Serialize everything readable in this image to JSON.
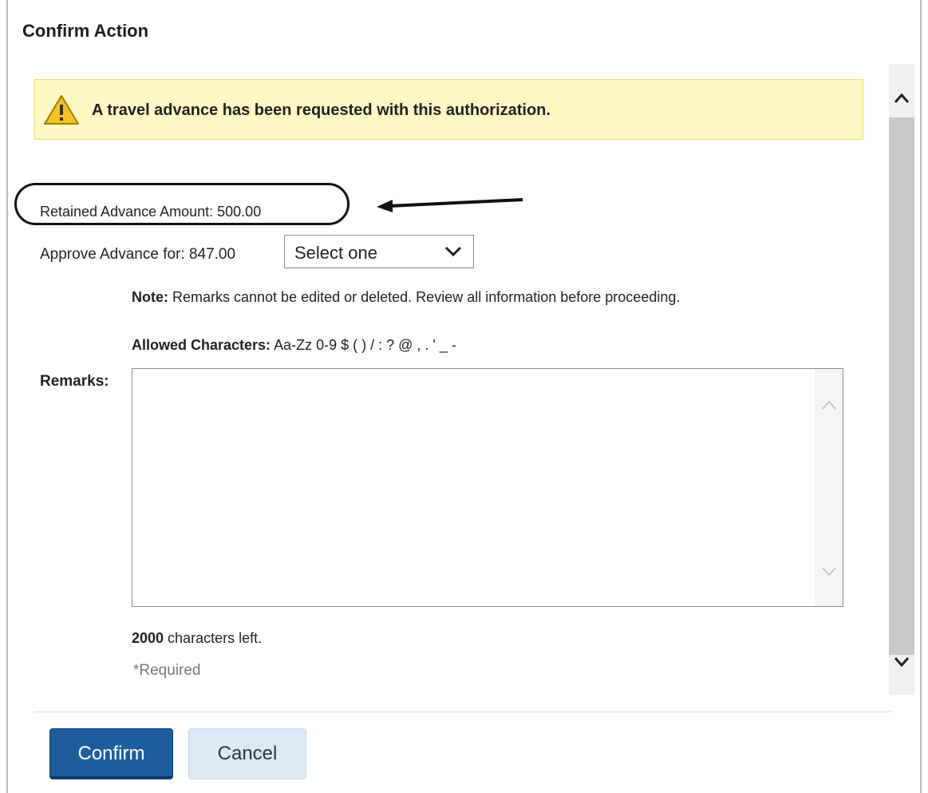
{
  "dialog": {
    "title": "Confirm Action"
  },
  "alert": {
    "icon": "warning-icon",
    "message": "A travel advance has been requested with this authorization."
  },
  "retained": {
    "label": "Retained Advance Amount: 500.00"
  },
  "approve": {
    "label": "Approve Advance for: 847.00",
    "select_value": "Select one"
  },
  "note": {
    "prefix": "Note:",
    "text": " Remarks cannot be edited or deleted. Review all information before proceeding."
  },
  "allowed": {
    "prefix": "Allowed Characters:",
    "text": " Aa-Zz 0-9 $ ( ) / : ? @ , . ' _ -"
  },
  "remarks": {
    "label": "Remarks:",
    "value": ""
  },
  "chars_left": {
    "count": "2000",
    "text": " characters left."
  },
  "required_text": "*Required",
  "buttons": {
    "confirm": "Confirm",
    "cancel": "Cancel"
  },
  "colors": {
    "alert_bg": "#fdf8c4",
    "confirm_bg": "#1d5d9e",
    "cancel_bg": "#dce8f6"
  }
}
